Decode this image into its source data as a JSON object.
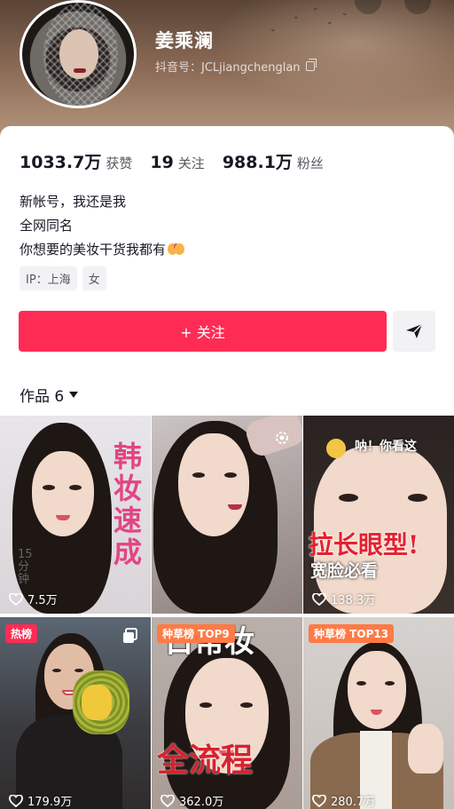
{
  "profile": {
    "name": "姜乘澜",
    "handle": "抖音号：JCLjiangchenglan"
  },
  "stats": [
    {
      "value": "1033.7万",
      "label": "获赞"
    },
    {
      "value": "19",
      "label": "关注"
    },
    {
      "value": "988.1万",
      "label": "粉丝"
    }
  ],
  "bio": {
    "line1": "新帐号，我还是我",
    "line2": "全网同名",
    "line3": "你想要的美妆干货我都有"
  },
  "tags": {
    "ip": "IP：上海",
    "gender": "女"
  },
  "actions": {
    "follow_label": "+ 关注"
  },
  "works": {
    "label": "作品 6"
  },
  "videos": [
    {
      "likes": "7.5万",
      "overlay_text": "韩妆速成",
      "small_text": "15分钟"
    },
    {
      "likes": ""
    },
    {
      "likes": "138.3万",
      "overlay_text": "拉长眼型!",
      "sub_text": "宽脸必看",
      "top_text": "呐！你看这"
    },
    {
      "likes": "179.9万",
      "badge": "热榜"
    },
    {
      "likes": "362.0万",
      "badge": "种草榜 TOP9",
      "overlay_text": "全流程",
      "top_text": "日常妆"
    },
    {
      "likes": "280.7万",
      "badge": "种草榜 TOP13"
    }
  ],
  "colors": {
    "accent": "#fe2c55",
    "badge_hot": "#fe2c55",
    "badge_rank": "#ff7a45"
  },
  "icons": [
    "copy-icon",
    "share-icon",
    "chevron-down-icon",
    "heart-icon",
    "settings-icon",
    "multi-image-icon"
  ]
}
